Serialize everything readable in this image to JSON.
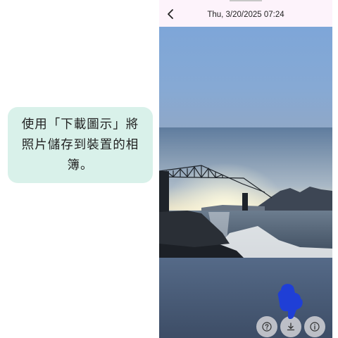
{
  "tutorial": {
    "callout_text": "使用「下載圖示」將照片儲存到裝置的相簿。"
  },
  "viewer": {
    "timestamp": "Thu, 3/20/2025 07:24",
    "back_icon": "chevron-left-icon",
    "actions": [
      {
        "name": "help-button",
        "icon": "question-circle-icon"
      },
      {
        "name": "download-button",
        "icon": "download-icon"
      },
      {
        "name": "info-button",
        "icon": "info-icon"
      }
    ],
    "pointer_icon": "pointing-hand-icon"
  },
  "colors": {
    "callout_bg": "#d9f1ea",
    "topbar_bg": "#fdf3fb",
    "pointer": "#1f3fd6"
  }
}
